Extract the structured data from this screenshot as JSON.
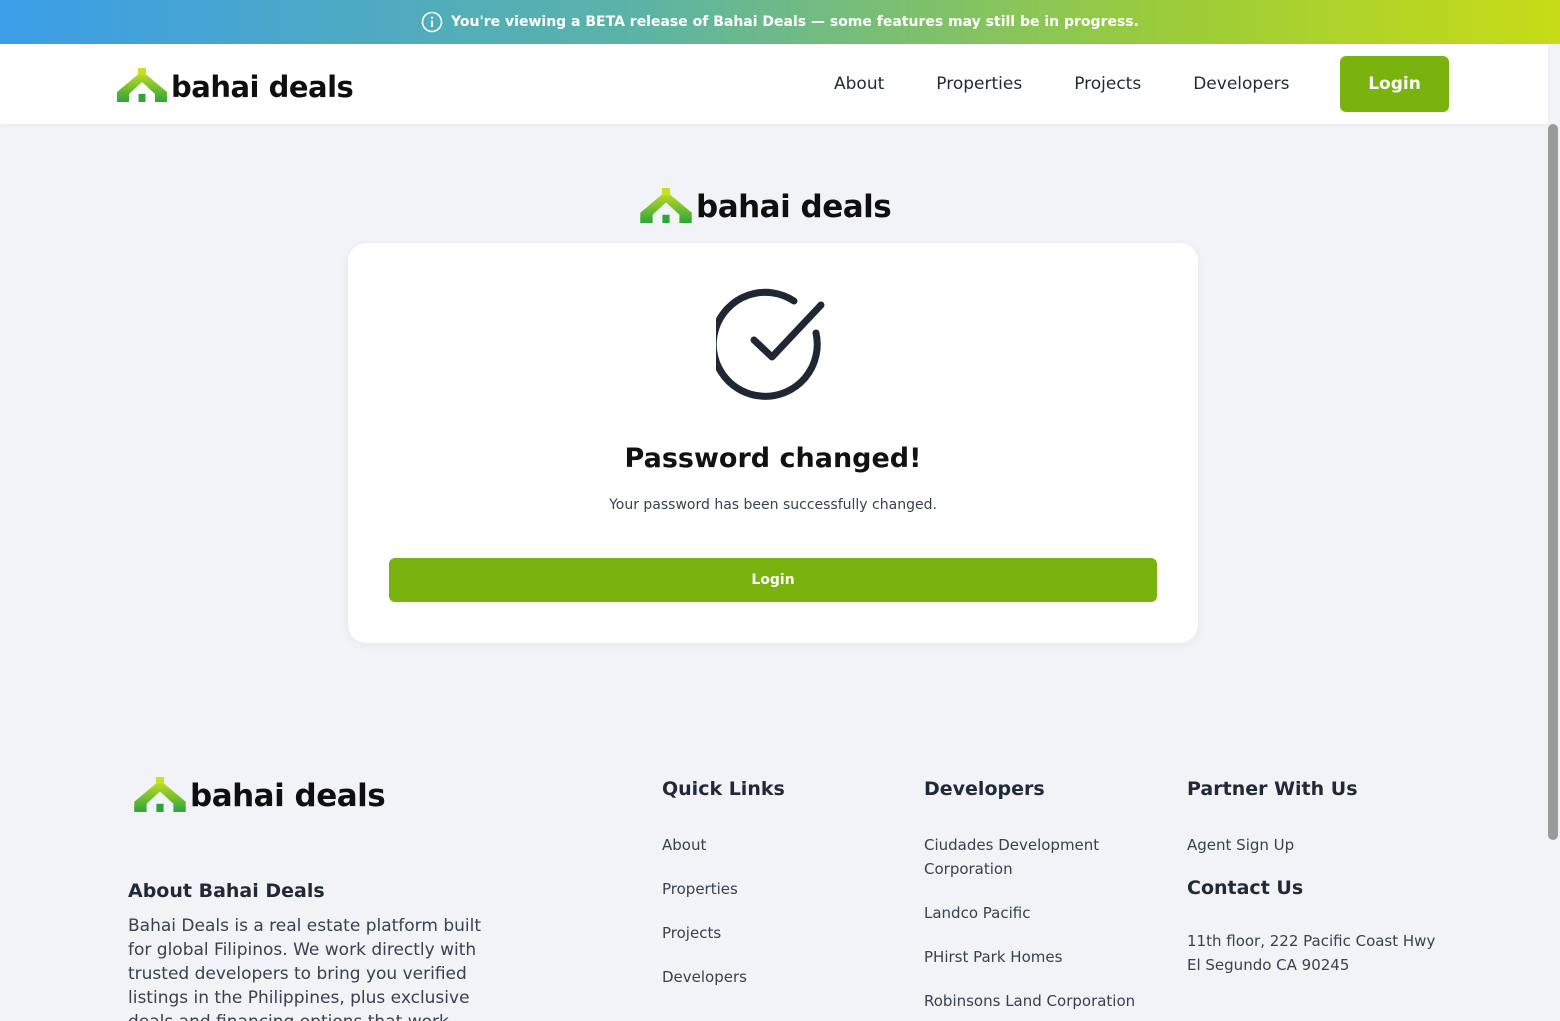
{
  "banner": {
    "text": "You're viewing a BETA release of Bahai Deals — some features may still be in progress.",
    "icon": "info-icon",
    "gradient": [
      "#3b9ee8",
      "#c7dc16"
    ]
  },
  "brand": {
    "name": "bahai deals",
    "accent": "#7ab20e",
    "logo_icon": "house-icon"
  },
  "nav": {
    "links": [
      "About",
      "Properties",
      "Projects",
      "Developers"
    ],
    "login_label": "Login"
  },
  "card": {
    "icon": "check-circle-icon",
    "title": "Password changed!",
    "message": "Your password has been successfully changed.",
    "button_label": "Login"
  },
  "footer": {
    "about_title": "About Bahai Deals",
    "about_text": "Bahai Deals is a real estate platform built for global Filipinos. We work directly with trusted developers to bring you verified listings in the Philippines, plus exclusive deals and financing options that work across borders.",
    "quick_links": {
      "title": "Quick Links",
      "items": [
        "About",
        "Properties",
        "Projects",
        "Developers"
      ]
    },
    "developers": {
      "title": "Developers",
      "items": [
        "Ciudades Development Corporation",
        "Landco Pacific",
        "PHirst Park Homes",
        "Robinsons Land Corporation"
      ]
    },
    "partner": {
      "title": "Partner With Us",
      "items": [
        "Agent Sign Up"
      ]
    },
    "contact": {
      "title": "Contact Us",
      "address": "11th floor, 222 Pacific Coast Hwy\nEl Segundo CA 90245"
    }
  }
}
